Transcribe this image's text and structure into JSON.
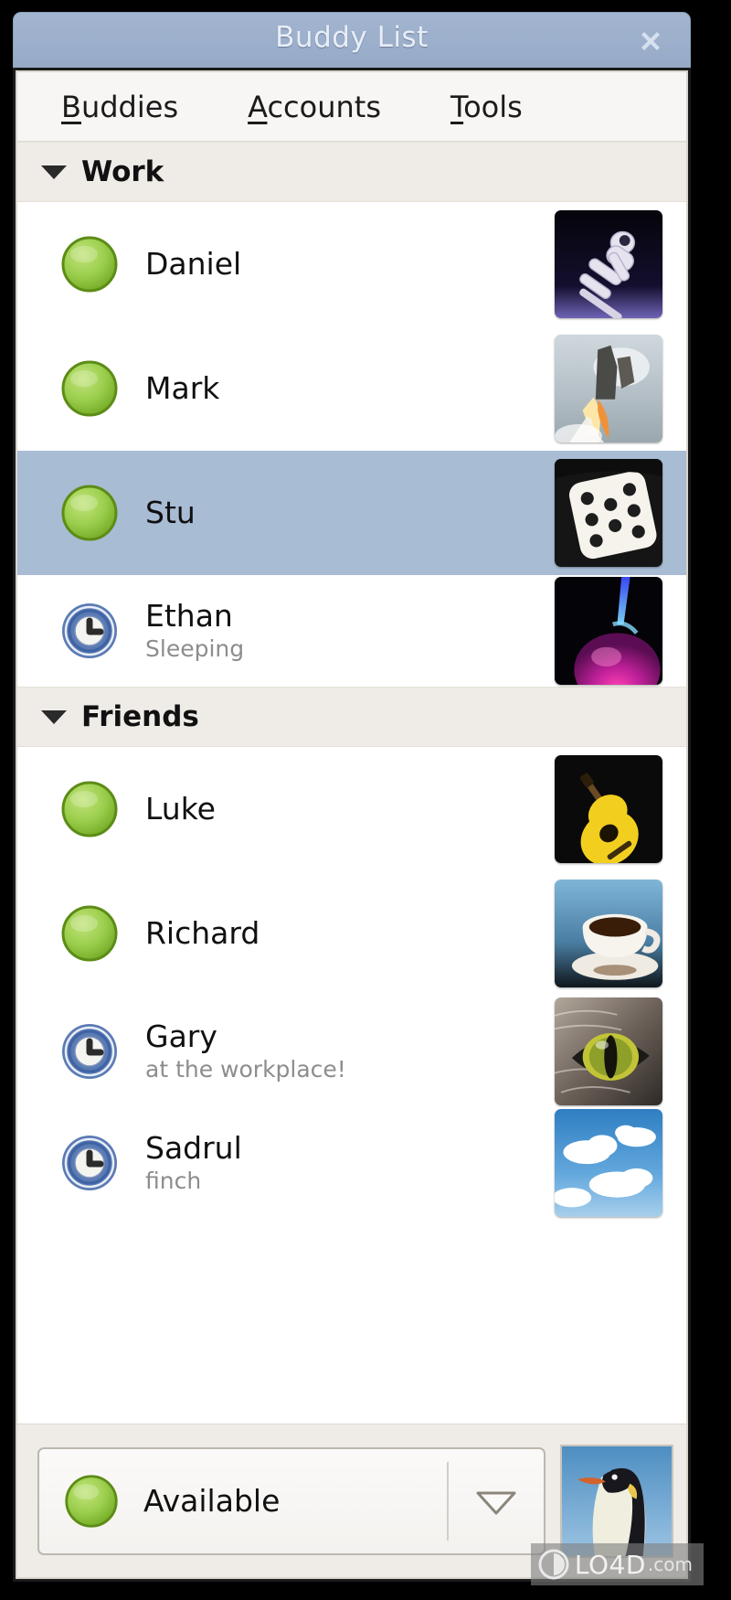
{
  "window": {
    "title": "Buddy List",
    "close_label": "✖",
    "titlebar_color": "#9cb0cc",
    "selection_color": "#a8bcd4",
    "group_header_color": "#efece7",
    "available_color": "#8cc63e"
  },
  "menubar": {
    "items": [
      {
        "mnemonic": "B",
        "rest": "uddies"
      },
      {
        "mnemonic": "A",
        "rest": "ccounts"
      },
      {
        "mnemonic": "T",
        "rest": "ools"
      }
    ]
  },
  "groups": [
    {
      "name": "Work",
      "expanded": true,
      "buddies": [
        {
          "name": "Daniel",
          "status": "",
          "presence": "available",
          "avatar": "astronaut",
          "selected": false
        },
        {
          "name": "Mark",
          "status": "",
          "presence": "available",
          "avatar": "rocket-launch",
          "selected": false
        },
        {
          "name": "Stu",
          "status": "",
          "presence": "available",
          "avatar": "dice",
          "selected": true
        },
        {
          "name": "Ethan",
          "status": "Sleeping",
          "presence": "away",
          "avatar": "plasma-lamp",
          "selected": false
        }
      ]
    },
    {
      "name": "Friends",
      "expanded": true,
      "buddies": [
        {
          "name": "Luke",
          "status": "",
          "presence": "available",
          "avatar": "guitar",
          "selected": false
        },
        {
          "name": "Richard",
          "status": "",
          "presence": "available",
          "avatar": "coffee-cup",
          "selected": false
        },
        {
          "name": "Gary",
          "status": "at the workplace!",
          "presence": "away",
          "avatar": "cat-eye",
          "selected": false
        },
        {
          "name": "Sadrul",
          "status": "finch",
          "presence": "away",
          "avatar": "clouds-sky",
          "selected": false
        }
      ]
    }
  ],
  "bottom": {
    "status_label": "Available",
    "status_presence": "available",
    "dropdown_icon": "chevron-down-icon",
    "my_avatar": "penguin"
  },
  "watermark": {
    "main": "LO4D",
    "sub": ".com"
  }
}
